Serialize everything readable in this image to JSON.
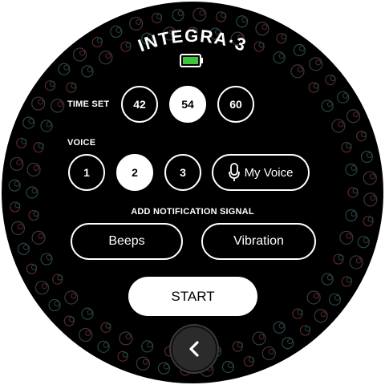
{
  "app": {
    "title": "INTEGRA·3"
  },
  "status": {
    "battery_icon": "battery-full-icon",
    "battery_color": "#3cc43c"
  },
  "time_set": {
    "label": "TIME SET",
    "options": [
      "42",
      "54",
      "60"
    ],
    "selected": "54"
  },
  "voice": {
    "label": "VOICE",
    "options": [
      "1",
      "2",
      "3"
    ],
    "selected": "2",
    "my_voice_label": "My Voice",
    "my_voice_icon": "microphone-icon"
  },
  "notification": {
    "label": "ADD NOTIFICATION SIGNAL",
    "beeps_label": "Beeps",
    "vibration_label": "Vibration"
  },
  "actions": {
    "start_label": "START",
    "back_icon": "chevron-left-icon"
  },
  "colors": {
    "background": "#000000",
    "foreground": "#ffffff",
    "decor_red": "#5a2a25",
    "decor_teal": "#1f4a45"
  }
}
